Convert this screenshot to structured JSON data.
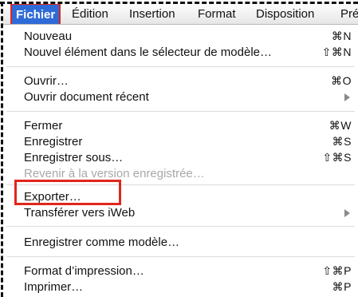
{
  "menubar": {
    "items": [
      "Fichier",
      "Édition",
      "Insertion",
      "Format",
      "Disposition",
      "Prés"
    ],
    "active": "Fichier"
  },
  "menu": {
    "groups": [
      [
        {
          "label": "Nouveau",
          "shortcut": "⌘N"
        },
        {
          "label": "Nouvel élément dans le sélecteur de modèle…",
          "shortcut": "⇧⌘N"
        }
      ],
      [
        {
          "label": "Ouvrir…",
          "shortcut": "⌘O"
        },
        {
          "label": "Ouvrir document récent",
          "shortcut": "",
          "submenu": true
        }
      ],
      [
        {
          "label": "Fermer",
          "shortcut": "⌘W"
        },
        {
          "label": "Enregistrer",
          "shortcut": "⌘S"
        },
        {
          "label": "Enregistrer sous…",
          "shortcut": "⇧⌘S"
        },
        {
          "label": "Revenir à la version enregistrée…",
          "shortcut": "",
          "disabled": true
        }
      ],
      [
        {
          "label": "Exporter…",
          "shortcut": ""
        },
        {
          "label": "Transférer vers iWeb",
          "shortcut": "",
          "submenu": true
        }
      ],
      [
        {
          "label": "Enregistrer comme modèle…",
          "shortcut": ""
        }
      ],
      [
        {
          "label": "Format d’impression…",
          "shortcut": "⇧⌘P"
        },
        {
          "label": "Imprimer…",
          "shortcut": "⌘P"
        }
      ]
    ]
  },
  "colors": {
    "active_menu_bg": "#2f6bd6",
    "annotation_red": "#e0261c",
    "disabled_text": "#a8a8a8"
  }
}
